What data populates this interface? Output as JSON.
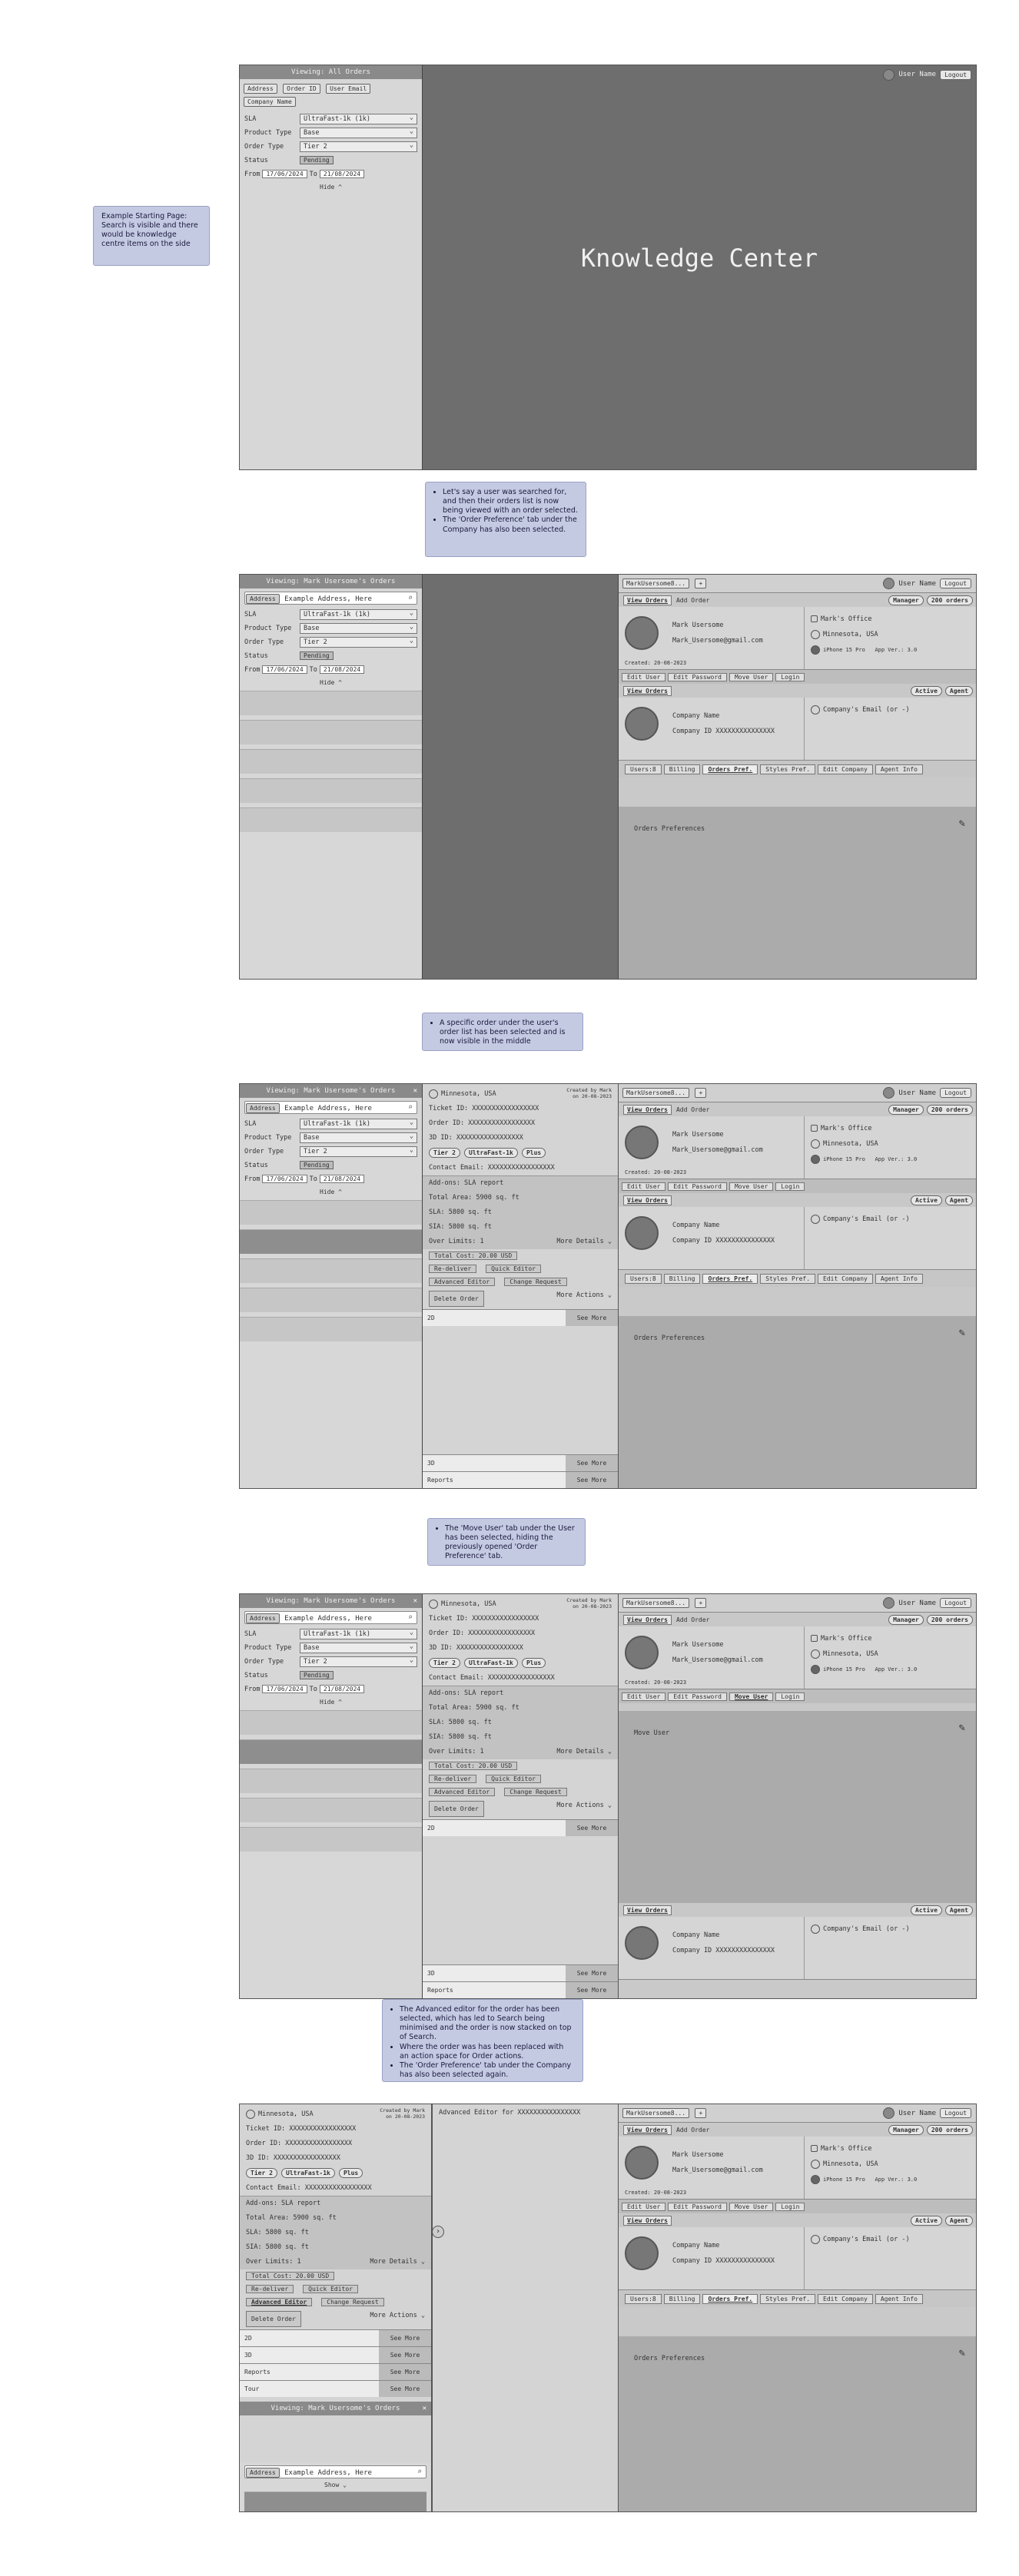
{
  "captions": {
    "c1": "Example Starting Page: Search is visible and there would be knowledge centre items on the side",
    "c2": [
      "Let's say a user was searched for, and then their orders list is now being viewed with an order selected.",
      "The 'Order Preference' tab under the Company has also been selected."
    ],
    "c3": [
      "A specific order under the user's order list has been selected and is now visible in the middle"
    ],
    "c4": [
      "The 'Move User' tab under the User has been selected, hiding the previously opened 'Order Preference' tab."
    ],
    "c5": [
      "The Advanced editor for the order has been selected, which has led to Search being minimised and the order is now stacked on top of Search.",
      "Where the order was has been replaced with an action space for Order actions.",
      "The 'Order Preference' tab under the Company has also been selected again."
    ]
  },
  "search": {
    "header_all": "Viewing: All Orders",
    "header_user": "Viewing: Mark Usersome's Orders",
    "chips": [
      "Address",
      "Order ID",
      "User Email",
      "Company Name"
    ],
    "address_chip": "Address",
    "address_value": "Example Address, Here",
    "filters": [
      {
        "label": "SLA",
        "value": "UltraFast-1k (1k)"
      },
      {
        "label": "Product Type",
        "value": "Base"
      },
      {
        "label": "Order Type",
        "value": "Tier 2"
      }
    ],
    "status_label": "Status",
    "status_value": "Pending",
    "from_label": "From",
    "from_value": "17/06/2024",
    "to_label": "To",
    "to_value": "21/08/2024",
    "hide": "Hide ^",
    "show": "Show ⌄"
  },
  "knowledge": "Knowledge Center",
  "topbar": {
    "user_name": "User Name",
    "logout": "Logout"
  },
  "user_panel": {
    "tab": "MarkUsersome8...",
    "view_orders": "View Orders",
    "add_order": "Add Order",
    "manager": "Manager",
    "orders_badge": "200 orders",
    "name": "Mark Usersome",
    "email": "Mark_Usersome@gmail.com",
    "created": "Created: 20-08-2023",
    "office": "Mark's Office",
    "location": "Minnesota, USA",
    "device": "iPhone 15 Pro",
    "app_ver": "App Ver.: 3.0",
    "actions": [
      "Edit User",
      "Edit Password",
      "Move User",
      "Login"
    ],
    "active": "Active",
    "agent": "Agent",
    "company_name": "Company Name",
    "company_id": "Company ID XXXXXXXXXXXXXXX",
    "company_email": "Company's Email (or -)",
    "tabs": [
      "Users:8",
      "Billing",
      "Orders Pref.",
      "Styles Pref.",
      "Edit Company",
      "Agent Info"
    ],
    "orders_pref": "Orders Preferences",
    "move_user": "Move User"
  },
  "order": {
    "location": "Minnesota, USA",
    "created_by": "Created by Mark on 20-08-2023",
    "ticket": "Ticket ID:   XXXXXXXXXXXXXXXXX",
    "order_id": "Order ID:   XXXXXXXXXXXXXXXXX",
    "3d_id": "3D ID:     XXXXXXXXXXXXXXXXX",
    "pills": [
      "Tier 2",
      "UltraFast-1k",
      "Plus"
    ],
    "contact": "Contact Email: XXXXXXXXXXXXXXXXX",
    "addons": "Add-ons:    SLA report",
    "total_area": "Total Area:  5900 sq. ft",
    "sla": "SLA:        5800 sq. ft",
    "sia": "SIA:        5800 sq. ft",
    "over_limits": "Over Limits: 1",
    "more_details": "More Details ⌄",
    "total_cost": "Total Cost: 20.00 USD",
    "buttons": [
      "Re-deliver",
      "Quick Editor",
      "Advanced Editor",
      "Change Request"
    ],
    "delete": "Delete Order",
    "more_actions": "More Actions ⌄",
    "see_more": "See More",
    "bars": [
      "2D",
      "3D",
      "Reports",
      "Tour"
    ]
  },
  "advanced_editor": "Advanced Editor for XXXXXXXXXXXXXXXX"
}
